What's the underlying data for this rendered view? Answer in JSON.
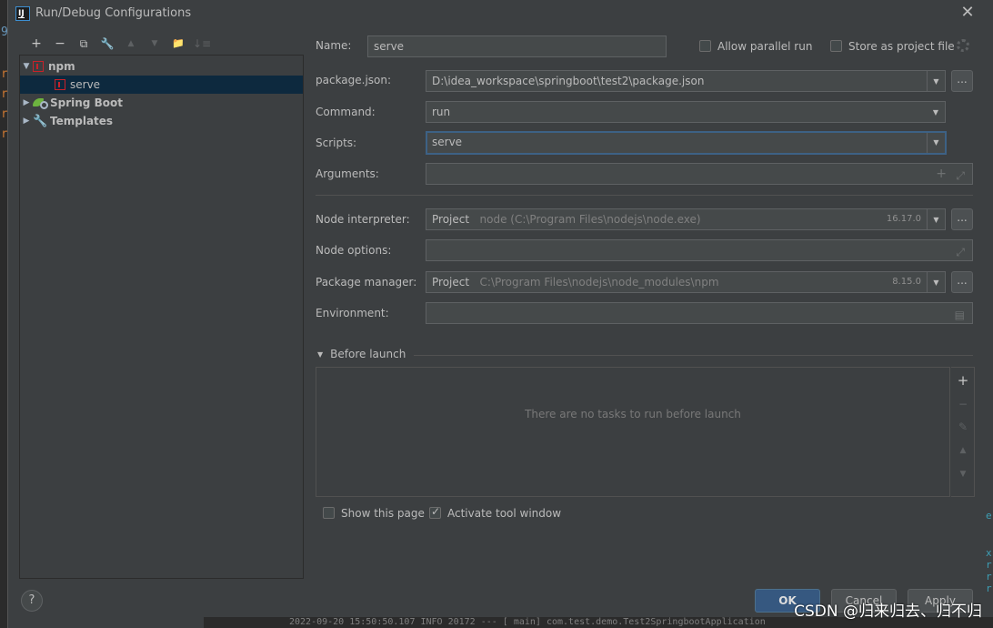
{
  "window": {
    "title": "Run/Debug Configurations",
    "app_icon_text": "IJ"
  },
  "toolbar": {
    "add": "+",
    "remove": "−",
    "copy": "⧉",
    "edit": "🔧",
    "up": "▲",
    "down": "▼",
    "folder": "▬",
    "sort": "↓"
  },
  "tree": {
    "npm_label": "npm",
    "serve_label": "serve",
    "spring_boot_label": "Spring Boot",
    "templates_label": "Templates"
  },
  "form": {
    "name_label": "Name:",
    "name_value": "serve",
    "allow_parallel_label": "Allow parallel run",
    "store_project_label": "Store as project file",
    "package_json_label": "package.json:",
    "package_json_value": "D:\\idea_workspace\\springboot\\test2\\package.json",
    "command_label": "Command:",
    "command_value": "run",
    "scripts_label": "Scripts:",
    "scripts_value": "serve",
    "arguments_label": "Arguments:",
    "arguments_value": "",
    "node_interpreter_label": "Node interpreter:",
    "node_interpreter_prefix": "Project",
    "node_interpreter_path": "node (C:\\Program Files\\nodejs\\node.exe)",
    "node_interpreter_version": "16.17.0",
    "node_options_label": "Node options:",
    "node_options_value": "",
    "package_manager_label": "Package manager:",
    "package_manager_prefix": "Project",
    "package_manager_path": "C:\\Program Files\\nodejs\\node_modules\\npm",
    "package_manager_version": "8.15.0",
    "environment_label": "Environment:",
    "environment_value": "",
    "browse_label": "..."
  },
  "before_launch": {
    "heading": "Before launch",
    "empty_text": "There are no tasks to run before launch"
  },
  "options": {
    "show_page_label": "Show this page",
    "show_page_checked": false,
    "activate_window_label": "Activate tool window",
    "activate_window_checked": true,
    "allow_parallel_checked": false,
    "store_project_checked": false
  },
  "buttons": {
    "help": "?",
    "ok": "OK",
    "cancel": "Cancel",
    "apply": "Apply"
  },
  "background": {
    "console_line": "2022-09-20 15:50:50.107  INFO 20172 --- [           main] com.test.demo.Test2SpringbootApplication",
    "watermark": "CSDN @归来归去、归不归"
  }
}
